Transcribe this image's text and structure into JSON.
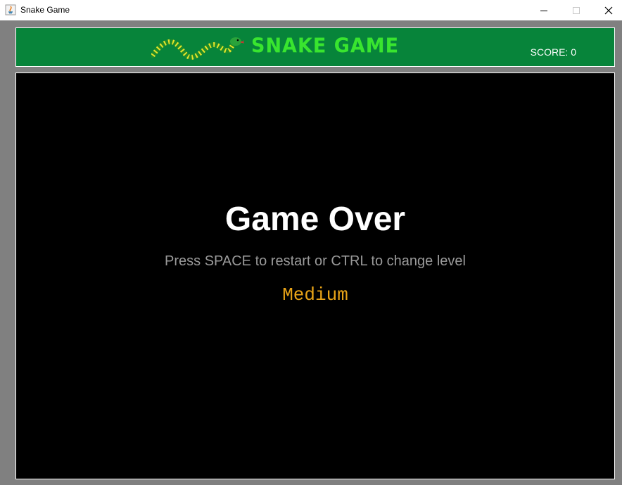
{
  "window": {
    "title": "Snake Game",
    "app_icon": "java-icon",
    "controls": [
      "minimize-icon",
      "maximize-icon",
      "close-icon"
    ]
  },
  "header": {
    "logo_icon": "snake-icon",
    "title": "SNAKE GAME",
    "score_text": "SCORE: 0"
  },
  "board": {
    "message": "Game Over",
    "hint": "Press SPACE to restart or CTRL to change level",
    "level": "Medium"
  },
  "colors": {
    "header_bg": "#07843a",
    "title_green": "#39e52f",
    "level_color": "#e8a317",
    "board_bg": "#000000"
  }
}
